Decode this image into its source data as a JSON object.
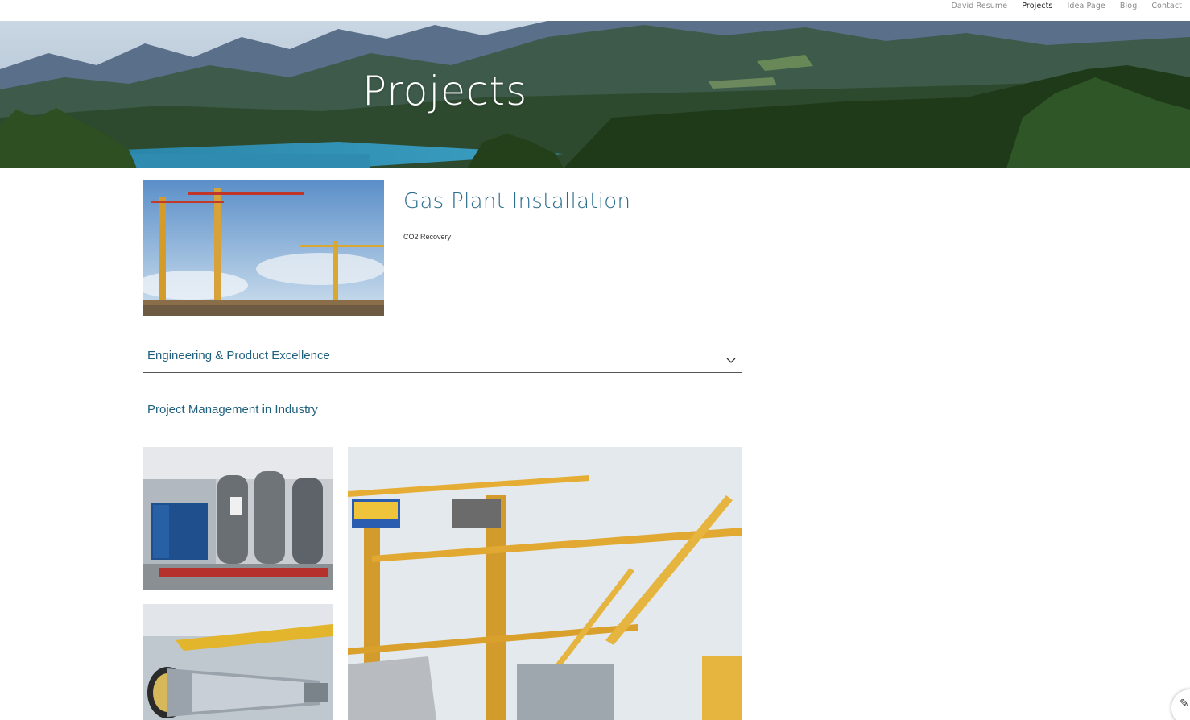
{
  "nav": {
    "items": [
      {
        "label": "David Resume",
        "active": false
      },
      {
        "label": "Projects",
        "active": true
      },
      {
        "label": "Idea Page",
        "active": false
      },
      {
        "label": "Blog",
        "active": false
      },
      {
        "label": "Contact",
        "active": false
      }
    ]
  },
  "hero": {
    "title": "Projects"
  },
  "featured": {
    "title": "Gas Plant Installation",
    "subtitle": "CO2 Recovery"
  },
  "accordion": {
    "label": "Engineering & Product Excellence",
    "icon": "chevron-down-icon"
  },
  "section": {
    "link_label": "Project Management in Industry"
  },
  "colors": {
    "accent": "#2c6d8d",
    "link": "#1f5f7e"
  }
}
